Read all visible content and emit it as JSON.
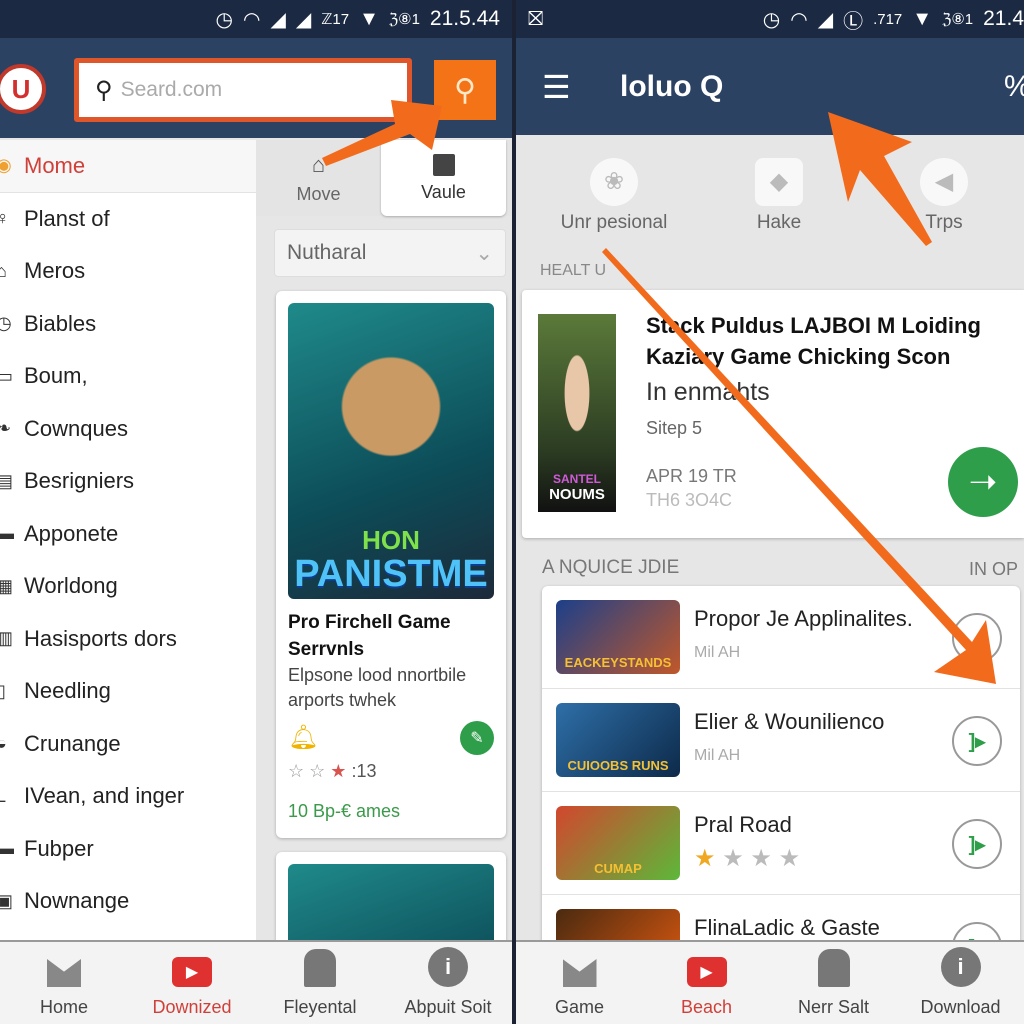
{
  "left": {
    "status": {
      "icons": [
        "alarm-icon",
        "wifi-icon",
        "signal-icon",
        "signal-icon"
      ],
      "text1": "ℤ17",
      "text2": "ℨ⑧1",
      "time": "21.5.44"
    },
    "search": {
      "placeholder": "Seard.com"
    },
    "logo": "U",
    "tabs": [
      {
        "label": "Move",
        "icon": "home-icon"
      },
      {
        "label": "Vaule",
        "icon": "bag-icon"
      }
    ],
    "sidebar": {
      "items": [
        {
          "label": "Mome",
          "active": true
        },
        {
          "label": "Planst of"
        },
        {
          "label": "Meros"
        },
        {
          "label": "Biables"
        },
        {
          "label": "Boum,"
        },
        {
          "label": "Cownques"
        },
        {
          "label": "Besrigniers"
        },
        {
          "label": "Apponete"
        },
        {
          "label": "Worldong"
        },
        {
          "label": "Hasisports dors"
        },
        {
          "label": "Needling"
        },
        {
          "label": "Crunange"
        },
        {
          "label": "IVean, and inger"
        },
        {
          "label": "Fubper"
        },
        {
          "label": "Nownange"
        }
      ]
    },
    "dropdown": {
      "value": "Nutharal"
    },
    "game_card": {
      "art_line1": "HON",
      "art_line2": "PANISTME",
      "title": "Pro Firchell Game Serrvnls",
      "description": "Elpsone lood nnortbile arports twhek",
      "rating_text": ":13",
      "rating": 1,
      "rating_max": 5,
      "footer": "10 Bp-€ ames"
    },
    "bottom_nav": [
      {
        "label": "Home",
        "icon": "inbox-icon"
      },
      {
        "label": "Downized",
        "icon": "play-icon",
        "active": true
      },
      {
        "label": "Fleyental",
        "icon": "lock-icon"
      },
      {
        "label": "Abpuit Soit",
        "icon": "info-icon"
      }
    ]
  },
  "right": {
    "status": {
      "text1": ".717",
      "text2": "ℨ⑧1",
      "time": "21.4"
    },
    "header": {
      "title": "loluo Q"
    },
    "categories": [
      {
        "label": "Unr pesional"
      },
      {
        "label": "Hake"
      },
      {
        "label": "Trps"
      }
    ],
    "section1": "HEALT U",
    "featured": {
      "poster_line1": "SANTEL",
      "poster_line2": "NOUMS",
      "title": "Stack Puldus LAJBOI M Loiding Kaziary Game Chicking Scon",
      "subtitle": "In enmahts",
      "step": "Sitep 5",
      "date": "APR 19 TR",
      "meta": "TH6 3O4C"
    },
    "section2": {
      "left": "A NQUICE JDIE",
      "right": "IN OP"
    },
    "list": [
      {
        "title": "Propor Je Applinalites.",
        "sub": "Mil AH",
        "thumb": "EACKEYSTANDS"
      },
      {
        "title": "Elier & Wounilienco",
        "sub": "Mil AH",
        "thumb": "CUIOOBS RUNS"
      },
      {
        "title": "Pral Road",
        "rating": 1,
        "rating_max": 4,
        "thumb": "CUMAP"
      },
      {
        "title": "FlinaLadic & Gaste",
        "thumb": ""
      }
    ],
    "bottom_nav": [
      {
        "label": "Game",
        "icon": "inbox-icon"
      },
      {
        "label": "Beach",
        "icon": "play-icon",
        "active": true
      },
      {
        "label": "Nerr Salt",
        "icon": "lock-icon"
      },
      {
        "label": "Download",
        "icon": "info-icon"
      }
    ]
  },
  "colors": {
    "accent_orange": "#f26a1b",
    "header_navy": "#2b4263",
    "status_navy": "#1b2a42",
    "green": "#2e9e4a",
    "red": "#d0403a"
  }
}
